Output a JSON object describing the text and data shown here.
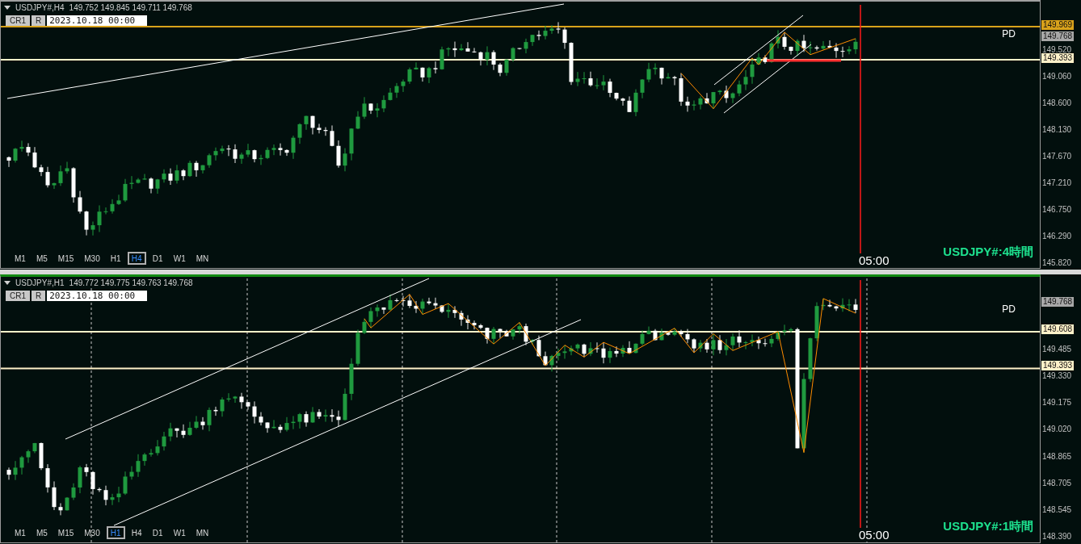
{
  "panels": [
    {
      "title": "USDJPY#,H4",
      "ohlc": "149.752 149.845 149.711 149.768",
      "buttons": [
        "CR1",
        "R"
      ],
      "date_field": "2023.10.18 00:00",
      "marker": "PD",
      "time_label": "05:00",
      "caption": "USDJPY#:4時間",
      "timeframes": [
        {
          "label": "M1",
          "selected": false
        },
        {
          "label": "M5",
          "selected": false
        },
        {
          "label": "M15",
          "selected": false
        },
        {
          "label": "M30",
          "selected": false
        },
        {
          "label": "H1",
          "selected": false
        },
        {
          "label": "H4",
          "selected": true
        },
        {
          "label": "D1",
          "selected": false
        },
        {
          "label": "W1",
          "selected": false
        },
        {
          "label": "MN",
          "selected": false
        }
      ],
      "axis_ticks": [
        "149.520",
        "149.060",
        "148.600",
        "148.130",
        "147.670",
        "147.210",
        "146.750",
        "146.290",
        "145.820"
      ],
      "price_tags": [
        {
          "kind": "high",
          "text": "149.969"
        },
        {
          "kind": "close",
          "text": "149.768"
        },
        {
          "kind": "level",
          "text": "149.393"
        }
      ]
    },
    {
      "title": "USDJPY#,H1",
      "ohlc": "149.772 149.775 149.763 149.768",
      "buttons": [
        "CR1",
        "R"
      ],
      "date_field": "2023.10.18 00:00",
      "marker": "PD",
      "time_label": "05:00",
      "caption": "USDJPY#:1時間",
      "timeframes": [
        {
          "label": "M1",
          "selected": false
        },
        {
          "label": "M5",
          "selected": false
        },
        {
          "label": "M15",
          "selected": false
        },
        {
          "label": "M30",
          "selected": false
        },
        {
          "label": "H1",
          "selected": true
        },
        {
          "label": "H4",
          "selected": false
        },
        {
          "label": "D1",
          "selected": false
        },
        {
          "label": "W1",
          "selected": false
        },
        {
          "label": "MN",
          "selected": false
        }
      ],
      "axis_ticks": [
        "149.485",
        "149.330",
        "149.175",
        "149.020",
        "148.865",
        "148.705",
        "148.545",
        "148.390"
      ],
      "price_tags": [
        {
          "kind": "close",
          "text": "149.768"
        },
        {
          "kind": "level",
          "text": "149.608"
        },
        {
          "kind": "level",
          "text": "149.393"
        }
      ]
    }
  ]
}
